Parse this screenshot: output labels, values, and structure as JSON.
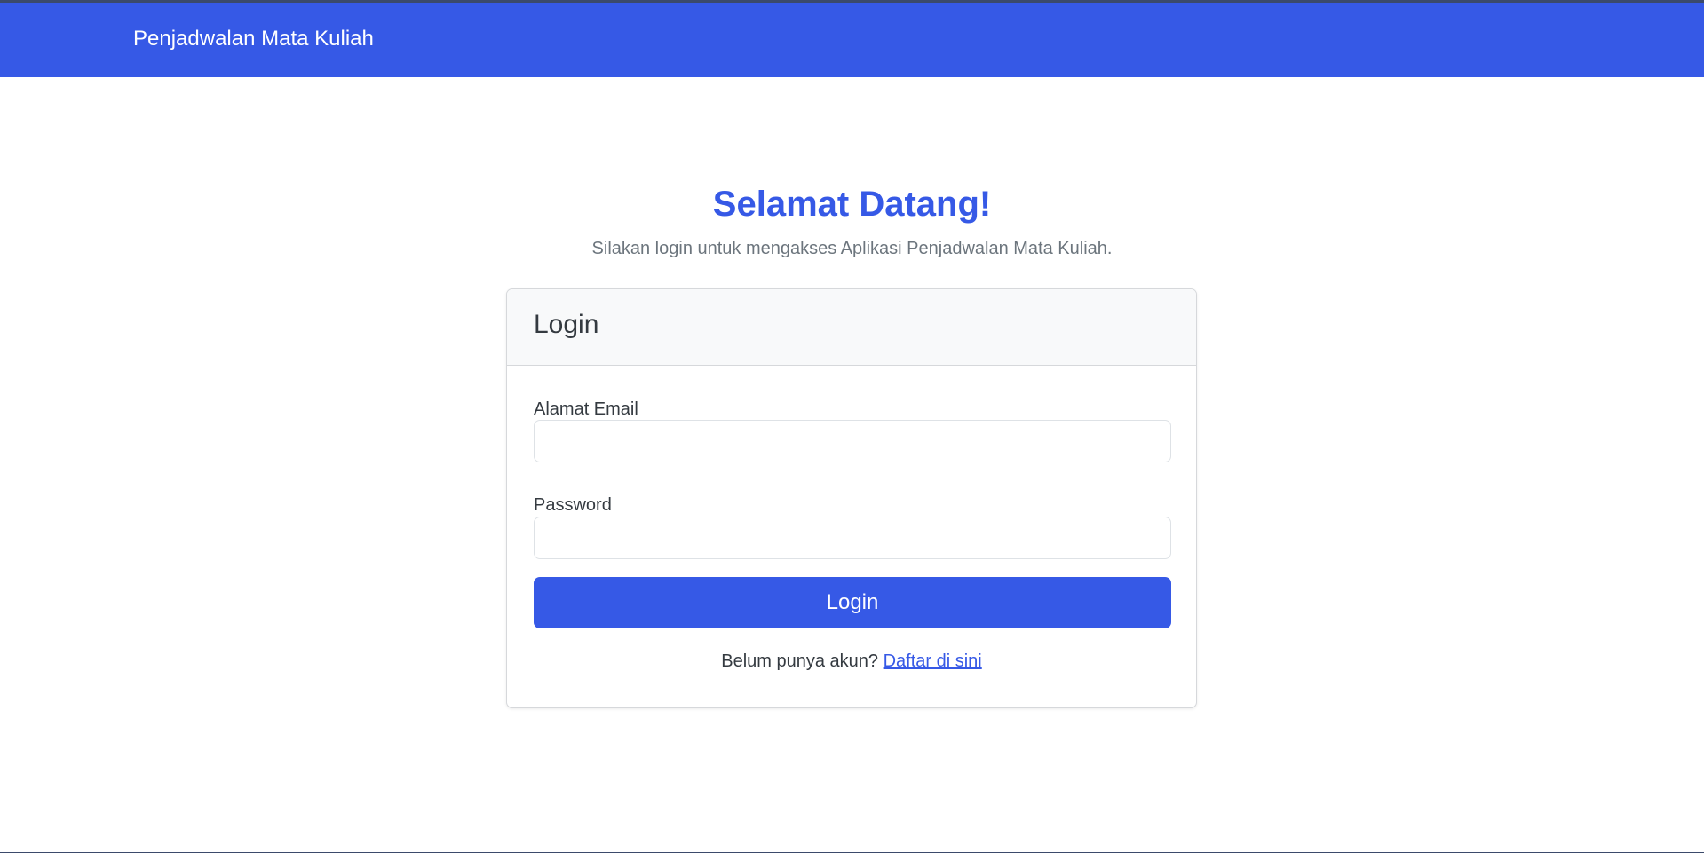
{
  "navbar": {
    "brand": "Penjadwalan Mata Kuliah"
  },
  "hero": {
    "title": "Selamat Datang!",
    "subtitle": "Silakan login untuk mengakses Aplikasi Penjadwalan Mata Kuliah."
  },
  "login_card": {
    "header": "Login",
    "email_label": "Alamat Email",
    "email_value": "",
    "email_placeholder": "",
    "password_label": "Password",
    "password_value": "",
    "password_placeholder": "",
    "submit_label": "Login",
    "register_prompt": "Belum punya akun?",
    "register_link": "Daftar di sini"
  },
  "colors": {
    "primary": "#3659e6",
    "muted_text": "#6c757d",
    "body_text": "#343a40",
    "card_header_bg": "#f8f9fa"
  }
}
